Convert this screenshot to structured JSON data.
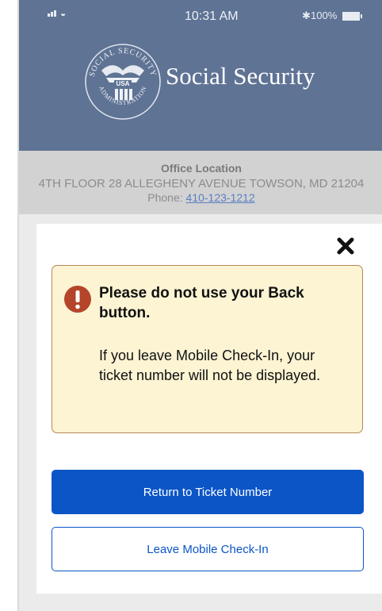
{
  "status_bar": {
    "time": "10:31 AM",
    "battery": "100%",
    "bluetooth_icon": "bluetooth-icon",
    "signal_icon": "signal-icon",
    "wifi_icon": "wifi-icon"
  },
  "header": {
    "title": "Social Security",
    "seal": {
      "top_text": "SOCIAL SECURITY",
      "bottom_text": "ADMINISTRATION",
      "center_text": "USA"
    }
  },
  "office": {
    "label": "Office Location",
    "address": "4TH FLOOR 28 ALLEGHENY AVENUE TOWSON, MD 21204",
    "phone_label": "Phone:",
    "phone": "410-123-1212"
  },
  "modal": {
    "close_icon": "close-icon",
    "alert": {
      "icon": "exclamation-icon",
      "heading": "Please do not use your Back button.",
      "body": "If you leave Mobile Check-In, your ticket number will not be displayed."
    },
    "primary_button": "Return to Ticket Number",
    "secondary_button": "Leave Mobile Check-In"
  },
  "colors": {
    "header_bg": "#5f7394",
    "office_bg": "#d2d2d2",
    "alert_bg": "#fcf4d3",
    "alert_border": "#b8875b",
    "alert_icon": "#b5452a",
    "primary": "#0b55c7",
    "link": "#5a7ec4"
  }
}
